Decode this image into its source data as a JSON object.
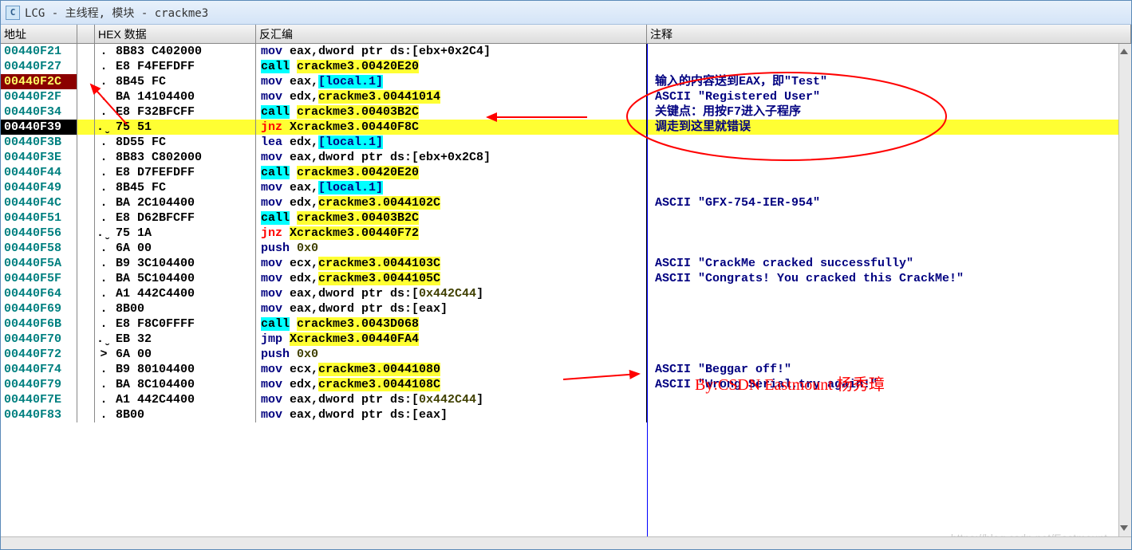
{
  "window": {
    "title": "LCG -  主线程, 模块 - crackme3"
  },
  "headers": {
    "addr": "地址",
    "hex": "HEX 数据",
    "disasm": "反汇编",
    "comment": "注释"
  },
  "rows": [
    {
      "addr": "00440F21",
      "mark": "",
      "flag": ".",
      "hex": "8B83 C402000",
      "mnem": "mov",
      "rest": " eax,dword ptr ds:[ebx+0x2C4]",
      "ops": [],
      "comment": ""
    },
    {
      "addr": "00440F27",
      "mark": "",
      "flag": ".",
      "hex": "E8 F4FEFDFF",
      "mnem": "call",
      "call": true,
      "rest": " ",
      "ops": [
        {
          "t": "sym-y",
          "v": "crackme3.00420E20"
        }
      ],
      "comment": ""
    },
    {
      "addr": "00440F2C",
      "bp": true,
      "mark": "",
      "flag": ".",
      "hex": "8B45 FC",
      "mnem": "mov",
      "rest": " eax,",
      "ops": [
        {
          "t": "local",
          "v": "[local.1]"
        }
      ],
      "comment": "输入的内容送到EAX，即\"Test\""
    },
    {
      "addr": "00440F2F",
      "mark": "",
      "flag": ".",
      "hex": "BA 14104400",
      "mnem": "mov",
      "rest": " edx,",
      "ops": [
        {
          "t": "sym-y",
          "v": "crackme3.00441014"
        }
      ],
      "comment": "ASCII \"Registered User\""
    },
    {
      "addr": "00440F34",
      "mark": "",
      "flag": ".",
      "hex": "E8 F32BFCFF",
      "mnem": "call",
      "call": true,
      "rest": " ",
      "ops": [
        {
          "t": "sym-y",
          "v": "crackme3.00403B2C"
        }
      ],
      "comment": "关键点：用按F7进入子程序"
    },
    {
      "addr": "00440F39",
      "sel": true,
      "hl": true,
      "mark": "",
      "flag": ".ˬ",
      "hex": "75 51",
      "mnem": "jnz",
      "jmp": true,
      "rest": " Xcrackme3.00440F8C",
      "ops": [],
      "comment": "调走到这里就错误"
    },
    {
      "addr": "00440F3B",
      "mark": "",
      "flag": ".",
      "hex": "8D55 FC",
      "mnem": "lea",
      "rest": " edx,",
      "ops": [
        {
          "t": "local",
          "v": "[local.1]"
        }
      ],
      "comment": ""
    },
    {
      "addr": "00440F3E",
      "mark": "",
      "flag": ".",
      "hex": "8B83 C802000",
      "mnem": "mov",
      "rest": " eax,dword ptr ds:[ebx+0x2C8]",
      "ops": [],
      "comment": ""
    },
    {
      "addr": "00440F44",
      "mark": "",
      "flag": ".",
      "hex": "E8 D7FEFDFF",
      "mnem": "call",
      "call": true,
      "rest": " ",
      "ops": [
        {
          "t": "sym-y",
          "v": "crackme3.00420E20"
        }
      ],
      "comment": ""
    },
    {
      "addr": "00440F49",
      "mark": "",
      "flag": ".",
      "hex": "8B45 FC",
      "mnem": "mov",
      "rest": " eax,",
      "ops": [
        {
          "t": "local",
          "v": "[local.1]"
        }
      ],
      "comment": ""
    },
    {
      "addr": "00440F4C",
      "mark": "",
      "flag": ".",
      "hex": "BA 2C104400",
      "mnem": "mov",
      "rest": " edx,",
      "ops": [
        {
          "t": "sym-y",
          "v": "crackme3.0044102C"
        }
      ],
      "comment": "ASCII \"GFX-754-IER-954\""
    },
    {
      "addr": "00440F51",
      "mark": "",
      "flag": ".",
      "hex": "E8 D62BFCFF",
      "mnem": "call",
      "call": true,
      "rest": " ",
      "ops": [
        {
          "t": "sym-y",
          "v": "crackme3.00403B2C"
        }
      ],
      "comment": ""
    },
    {
      "addr": "00440F56",
      "mark": "",
      "flag": ".ˬ",
      "hex": "75 1A",
      "mnem": "jnz",
      "jmp": true,
      "rest": " ",
      "ops": [
        {
          "t": "sym-y",
          "v": "Xcrackme3.00440F72"
        }
      ],
      "comment": ""
    },
    {
      "addr": "00440F58",
      "mark": "",
      "flag": ".",
      "hex": "6A 00",
      "mnem": "push",
      "rest": " ",
      "ops": [
        {
          "t": "num",
          "v": "0x0"
        }
      ],
      "comment": ""
    },
    {
      "addr": "00440F5A",
      "mark": "",
      "flag": ".",
      "hex": "B9 3C104400",
      "mnem": "mov",
      "rest": " ecx,",
      "ops": [
        {
          "t": "sym-y",
          "v": "crackme3.0044103C"
        }
      ],
      "comment": "ASCII \"CrackMe cracked successfully\""
    },
    {
      "addr": "00440F5F",
      "mark": "",
      "flag": ".",
      "hex": "BA 5C104400",
      "mnem": "mov",
      "rest": " edx,",
      "ops": [
        {
          "t": "sym-y",
          "v": "crackme3.0044105C"
        }
      ],
      "comment": "ASCII \"Congrats! You cracked this CrackMe!\""
    },
    {
      "addr": "00440F64",
      "mark": "",
      "flag": ".",
      "hex": "A1 442C4400",
      "mnem": "mov",
      "rest": " eax,dword ptr ds:[",
      "ops": [
        {
          "t": "num",
          "v": "0x442C44"
        },
        {
          "t": "plain",
          "v": "]"
        }
      ],
      "comment": ""
    },
    {
      "addr": "00440F69",
      "mark": "",
      "flag": ".",
      "hex": "8B00",
      "mnem": "mov",
      "rest": " eax,dword ptr ds:[eax]",
      "ops": [],
      "comment": ""
    },
    {
      "addr": "00440F6B",
      "mark": "",
      "flag": ".",
      "hex": "E8 F8C0FFFF",
      "mnem": "call",
      "call": true,
      "rest": " ",
      "ops": [
        {
          "t": "sym-y",
          "v": "crackme3.0043D068"
        }
      ],
      "comment": ""
    },
    {
      "addr": "00440F70",
      "mark": "",
      "flag": ".ˬ",
      "hex": "EB 32",
      "mnem": "jmp",
      "jmp": false,
      "rest": " ",
      "ops": [
        {
          "t": "sym-y",
          "v": "Xcrackme3.00440FA4"
        }
      ],
      "comment": ""
    },
    {
      "addr": "00440F72",
      "mark": "",
      "flag": ">",
      "hex": "6A 00",
      "mnem": "push",
      "rest": " ",
      "ops": [
        {
          "t": "num",
          "v": "0x0"
        }
      ],
      "comment": ""
    },
    {
      "addr": "00440F74",
      "mark": "",
      "flag": ".",
      "hex": "B9 80104400",
      "mnem": "mov",
      "rest": " ecx,",
      "ops": [
        {
          "t": "sym-y",
          "v": "crackme3.00441080"
        }
      ],
      "comment": "ASCII \"Beggar off!\""
    },
    {
      "addr": "00440F79",
      "mark": "",
      "flag": ".",
      "hex": "BA 8C104400",
      "mnem": "mov",
      "rest": " edx,",
      "ops": [
        {
          "t": "sym-y",
          "v": "crackme3.0044108C"
        }
      ],
      "comment": "ASCII \"Wrong Serial,try again!\""
    },
    {
      "addr": "00440F7E",
      "mark": "",
      "flag": ".",
      "hex": "A1 442C4400",
      "mnem": "mov",
      "rest": " eax,dword ptr ds:[",
      "ops": [
        {
          "t": "num",
          "v": "0x442C44"
        },
        {
          "t": "plain",
          "v": "]"
        }
      ],
      "comment": ""
    },
    {
      "addr": "00440F83",
      "mark": "",
      "flag": ".",
      "hex": "8B00",
      "mnem": "mov",
      "rest": " eax,dword ptr ds:[eax]",
      "ops": [],
      "comment": ""
    }
  ],
  "credit": "By:CSDN Eastmount 杨秀璋",
  "watermark": "https://blog.csdn.net/Eastmount"
}
